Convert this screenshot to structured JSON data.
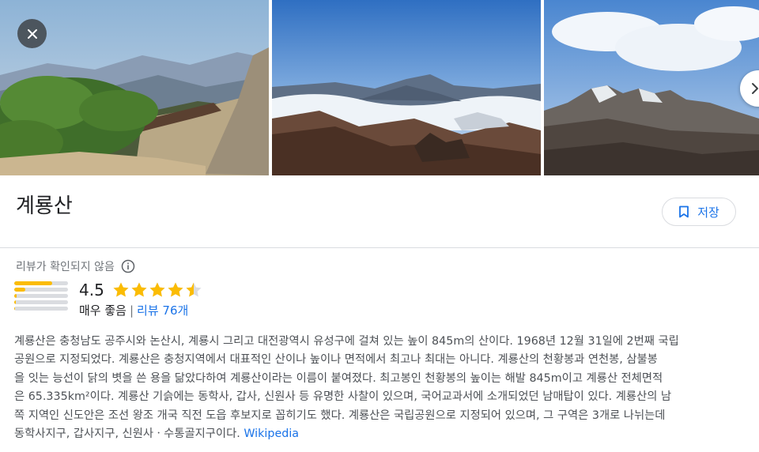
{
  "place": {
    "title": "계룡산",
    "save_label": "저장"
  },
  "photos": [
    {
      "name": "mountain-pine-photo"
    },
    {
      "name": "sea-of-clouds-photo"
    },
    {
      "name": "rocky-ridge-photo"
    }
  ],
  "rating": {
    "status": "리뷰가 확인되지 않음",
    "score": "4.5",
    "score_value": 4.5,
    "max_stars": 5,
    "label": "매우 좋음",
    "separator": "|",
    "reviews_link": "리뷰 76개",
    "distribution": [
      0.7,
      0.2,
      0.05,
      0.03,
      0.02
    ]
  },
  "description": {
    "lines": [
      "계룡산은 충청남도 공주시와 논산시, 계룡시 그리고 대전광역시 유성구에 걸쳐 있는 높이 845m의 산이다. 1968년 12월 31일에 2번째 국립",
      "공원으로 지정되었다. 계룡산은 충청지역에서 대표적인 산이나 높이나 면적에서 최고나 최대는 아니다. 계룡산의 천황봉과 연천봉, 삼불봉",
      "을 잇는 능선이 닭의 볏을 쓴 용을 닮았다하여 계룡산이라는 이름이 붙여졌다. 최고봉인 천황봉의 높이는 해발 845m이고 계룡산 전체면적",
      "은 65.335km²이다. 계룡산 기슭에는 동학사, 갑사, 신원사 등 유명한 사찰이 있으며, 국어교과서에 소개되었던 남매탑이 있다. 계룡산의 남",
      "쪽 지역인 신도안은 조선 왕조 개국 직전 도읍 후보지로 꼽히기도 했다. 계룡산은 국립공원으로 지정되어 있으며, 그 구역은 3개로 나뉘는데"
    ],
    "last_line": "동학사지구, 갑사지구, 신원사ㆍ수통골지구이다.",
    "source_link": "Wikipedia"
  },
  "icons": {
    "close": "close-icon",
    "next": "chevron-right-icon",
    "save": "bookmark-icon",
    "info": "info-icon",
    "star": "star-icon"
  },
  "colors": {
    "accent": "#1a73e8",
    "star": "#fbbc04",
    "star_empty": "#dadce0",
    "text": "#202124",
    "muted": "#70757a"
  }
}
